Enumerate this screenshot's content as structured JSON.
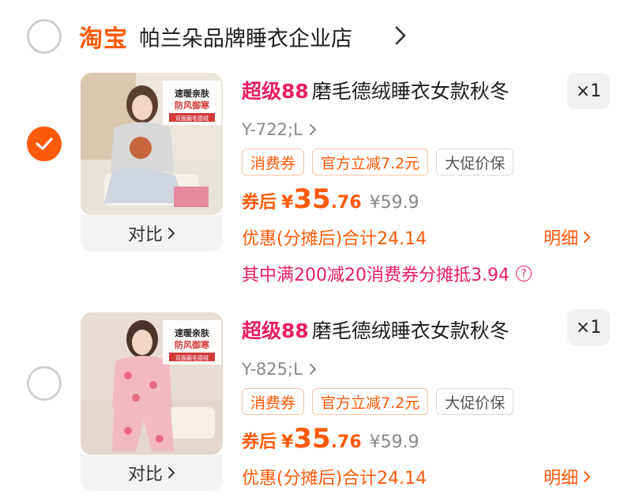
{
  "store": {
    "logo": "淘宝",
    "name": "帕兰朵品牌睡衣企业店",
    "selected": false
  },
  "items": [
    {
      "selected": true,
      "thumb": {
        "badge_line1": "速暖亲肤",
        "badge_line2": "防风御寒",
        "badge_line3": "双面磨毛德绒"
      },
      "compare_label": "对比",
      "title_tag": "超级88",
      "title": "磨毛德绒睡衣女款秋冬",
      "qty": "×1",
      "sku": "Y-722;L",
      "badges": [
        "消费券",
        "官方立减7.2元",
        "大促价保"
      ],
      "price_lead": "券后",
      "price_currency": "¥",
      "price_int": "35",
      "price_dec": ".76",
      "price_original": "¥59.9",
      "discount_text": "优惠(分摊后)合计24.14",
      "detail_label": "明细",
      "coupon_note": "其中满200减20消费券分摊抵3.94"
    },
    {
      "selected": false,
      "thumb": {
        "badge_line1": "速暖亲肤",
        "badge_line2": "防风御寒",
        "badge_line3": "双面磨毛德绒"
      },
      "compare_label": "对比",
      "title_tag": "超级88",
      "title": "磨毛德绒睡衣女款秋冬",
      "qty": "×1",
      "sku": "Y-825;L",
      "badges": [
        "消费券",
        "官方立减7.2元",
        "大促价保"
      ],
      "price_lead": "券后",
      "price_currency": "¥",
      "price_int": "35",
      "price_dec": ".76",
      "price_original": "¥59.9",
      "discount_text": "优惠(分摊后)合计24.14",
      "detail_label": "明细"
    }
  ],
  "colors": {
    "accent": "#ff5a0a",
    "promo_pink": "#e91e63"
  }
}
